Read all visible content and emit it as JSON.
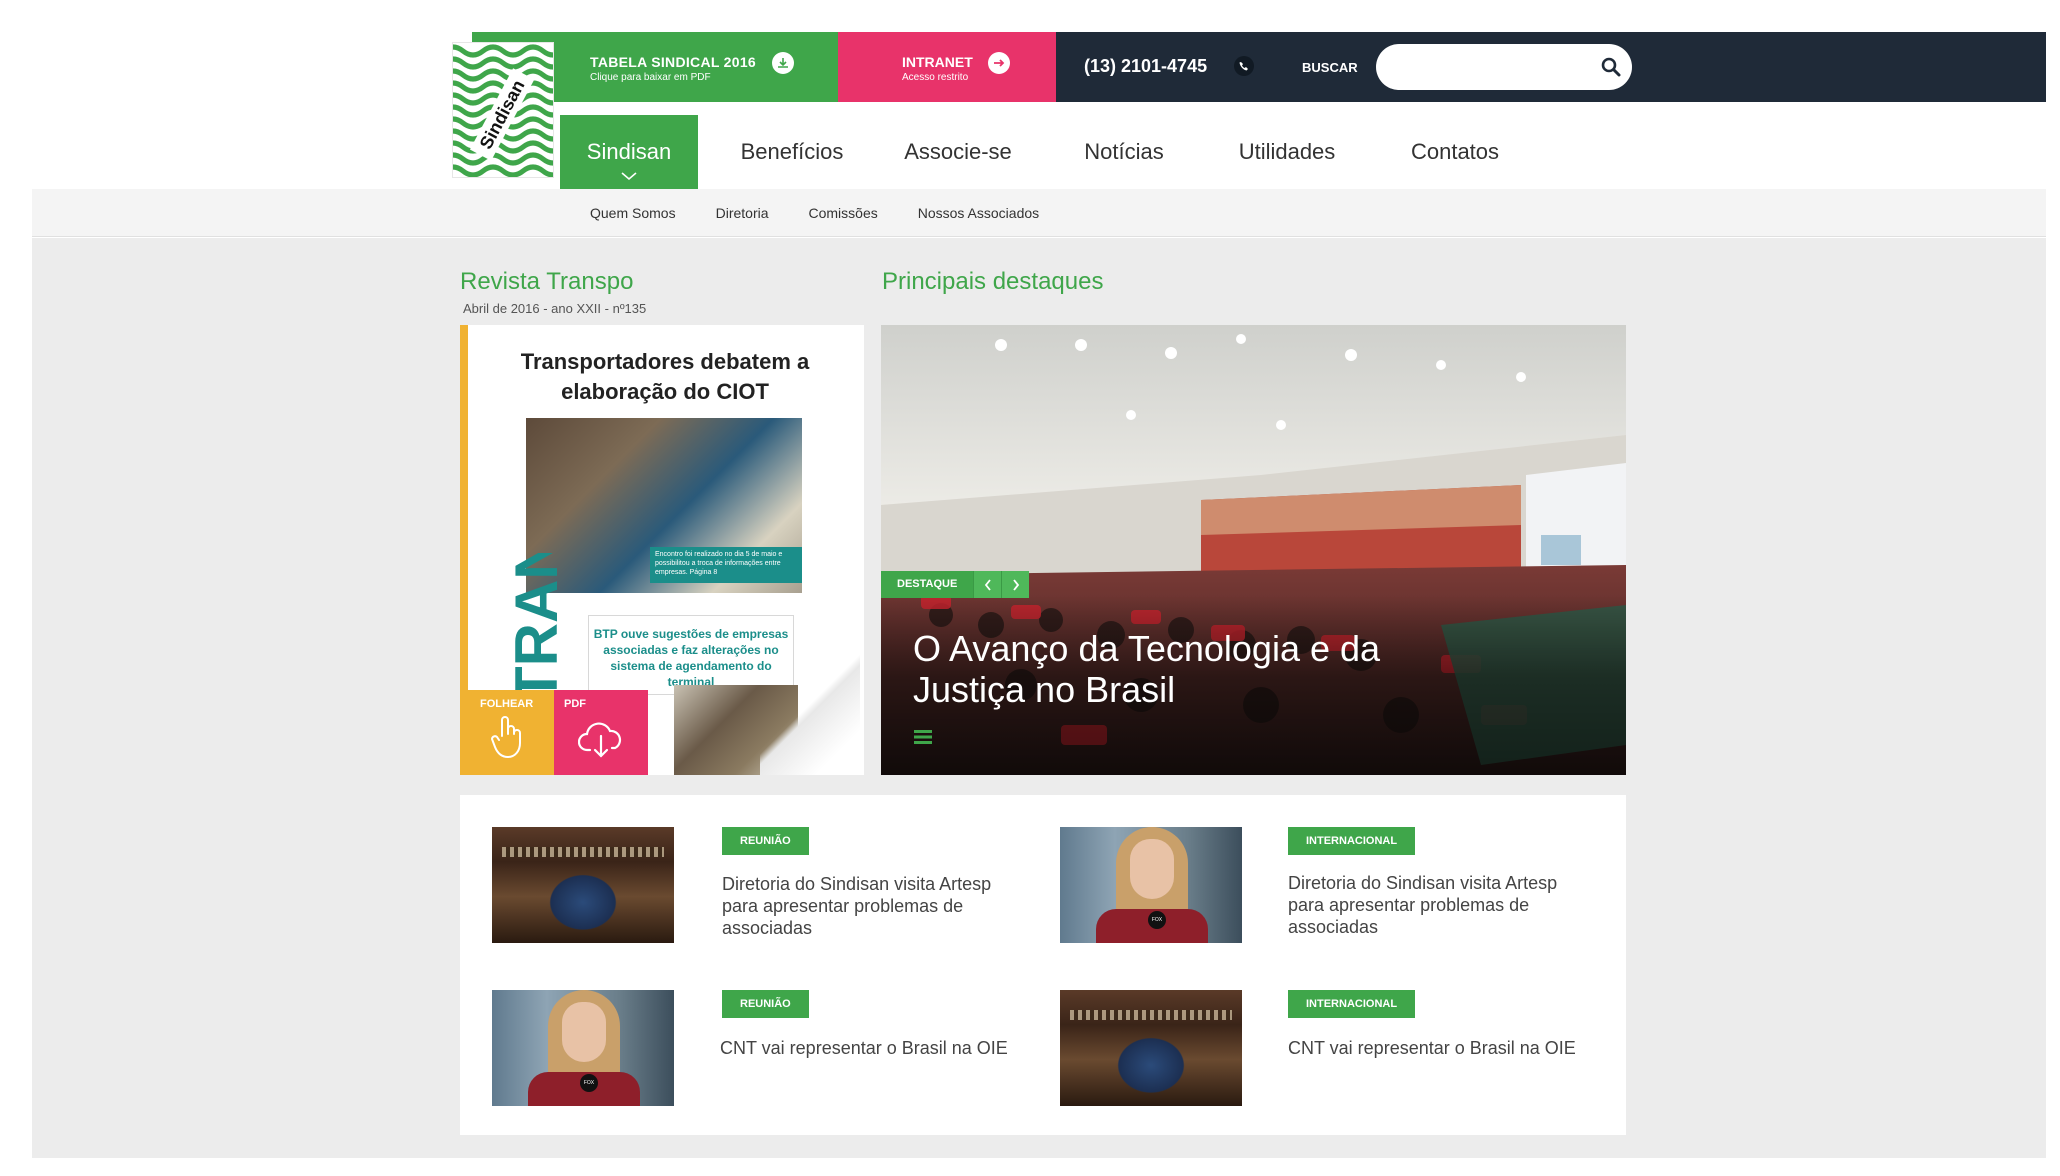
{
  "header": {
    "tabela": {
      "title": "TABELA SINDICAL 2016",
      "subtitle": "Clique para baixar em PDF",
      "icon": "download-icon"
    },
    "intranet": {
      "title": "INTRANET",
      "subtitle": "Acesso restrito",
      "icon": "arrow-right-icon"
    },
    "phone": "(13) 2101-4745",
    "search": {
      "label": "BUSCAR",
      "placeholder": "",
      "value": ""
    },
    "logo_text": "Sindisan"
  },
  "nav": {
    "items": [
      {
        "label": "Sindisan",
        "active": true
      },
      {
        "label": "Benefícios"
      },
      {
        "label": "Associe-se"
      },
      {
        "label": "Notícias"
      },
      {
        "label": "Utilidades"
      },
      {
        "label": "Contatos"
      }
    ]
  },
  "subnav": {
    "items": [
      {
        "label": "Quem Somos"
      },
      {
        "label": "Diretoria"
      },
      {
        "label": "Comissões"
      },
      {
        "label": "Nossos Associados"
      }
    ]
  },
  "revista": {
    "section_title": "Revista Transpo",
    "edition": "Abril de 2016 - ano XXII - nº135",
    "cover_headline": "Transportadores debatem a elaboração do CIOT",
    "cover_masthead": "TRANSPO",
    "cover_caption": "Encontro foi realizado no dia 5 de maio e possibilitou a troca de informações entre empresas. Página 8",
    "cover_story2": "BTP ouve sugestões de empresas associadas e faz alterações no sistema de agendamento do terminal",
    "folhear_label": "FOLHEAR",
    "pdf_label": "PDF"
  },
  "destaques": {
    "section_title": "Principais destaques",
    "badge": "DESTAQUE",
    "title": "O Avanço da Tecnologia e da Justiça no Brasil"
  },
  "news": [
    {
      "tag": "REUNIÃO",
      "title": "Diretoria do Sindisan visita Artesp para apresentar problemas de associadas",
      "thumb": "senate"
    },
    {
      "tag": "INTERNACIONAL",
      "title": "Diretoria do Sindisan visita Artesp para apresentar problemas de associadas",
      "thumb": "woman"
    },
    {
      "tag": "REUNIÃO",
      "title": "CNT vai representar o Brasil na OIE",
      "thumb": "woman"
    },
    {
      "tag": "INTERNACIONAL",
      "title": "CNT vai representar o Brasil na OIE",
      "thumb": "senate"
    }
  ],
  "colors": {
    "green": "#3fa64a",
    "pink": "#e8336a",
    "dark": "#1f2a38",
    "orange": "#f0b232",
    "teal": "#1b8e8a"
  }
}
